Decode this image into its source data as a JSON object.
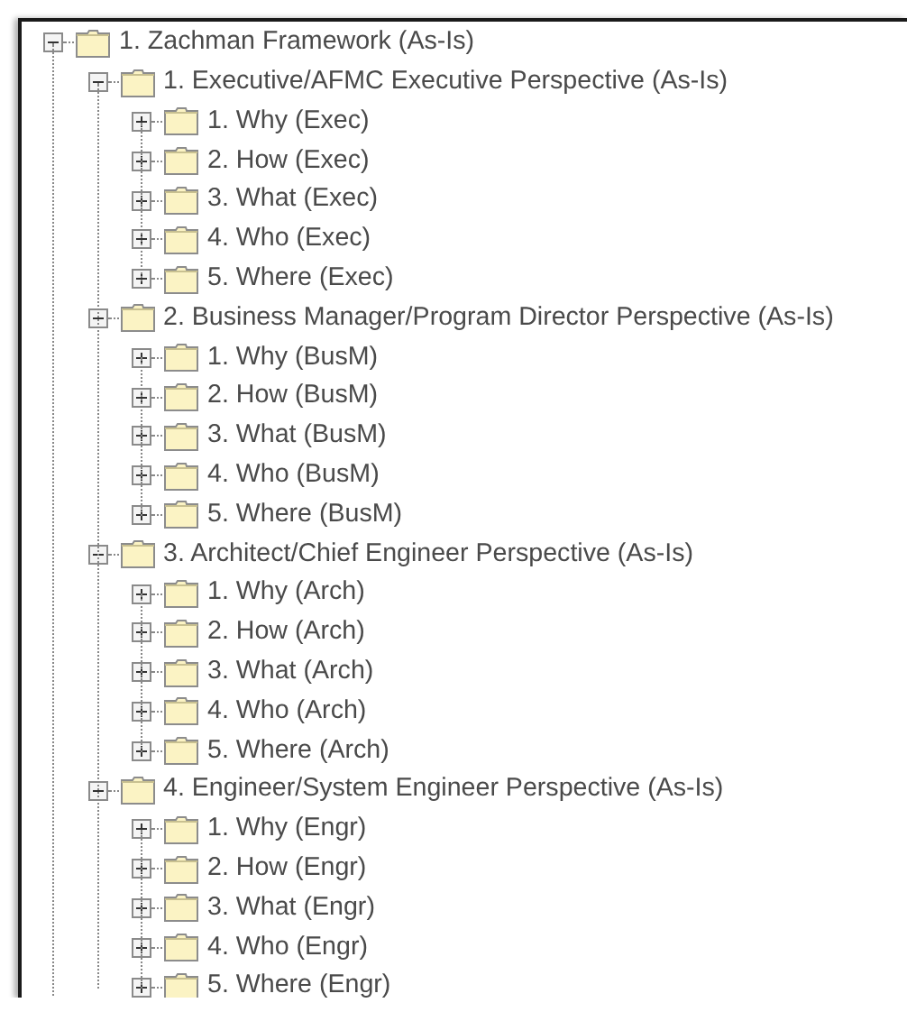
{
  "tree": [
    {
      "label": "1. Zachman Framework (As-Is)",
      "expanded": true,
      "children": [
        {
          "label": "1. Executive/AFMC Executive Perspective (As-Is)",
          "expanded": true,
          "children": [
            {
              "label": "1. Why (Exec)",
              "expanded": false
            },
            {
              "label": "2. How (Exec)",
              "expanded": false
            },
            {
              "label": "3. What (Exec)",
              "expanded": false
            },
            {
              "label": "4. Who (Exec)",
              "expanded": false
            },
            {
              "label": "5. Where (Exec)",
              "expanded": false
            }
          ]
        },
        {
          "label": "2. Business Manager/Program Director Perspective (As-Is)",
          "expanded": true,
          "children": [
            {
              "label": "1. Why (BusM)",
              "expanded": false
            },
            {
              "label": "2. How (BusM)",
              "expanded": false
            },
            {
              "label": "3. What (BusM)",
              "expanded": false
            },
            {
              "label": "4. Who (BusM)",
              "expanded": false
            },
            {
              "label": "5. Where (BusM)",
              "expanded": false
            }
          ]
        },
        {
          "label": "3. Architect/Chief Engineer Perspective (As-Is)",
          "expanded": true,
          "children": [
            {
              "label": "1. Why (Arch)",
              "expanded": false
            },
            {
              "label": "2. How (Arch)",
              "expanded": false
            },
            {
              "label": "3. What (Arch)",
              "expanded": false
            },
            {
              "label": "4. Who (Arch)",
              "expanded": false
            },
            {
              "label": "5. Where (Arch)",
              "expanded": false
            }
          ]
        },
        {
          "label": "4. Engineer/System Engineer Perspective (As-Is)",
          "expanded": true,
          "children": [
            {
              "label": "1. Why (Engr)",
              "expanded": false
            },
            {
              "label": "2. How (Engr)",
              "expanded": false
            },
            {
              "label": "3. What (Engr)",
              "expanded": false
            },
            {
              "label": "4. Who (Engr)",
              "expanded": false
            },
            {
              "label": "5. Where (Engr)",
              "expanded": false
            }
          ]
        }
      ]
    }
  ]
}
